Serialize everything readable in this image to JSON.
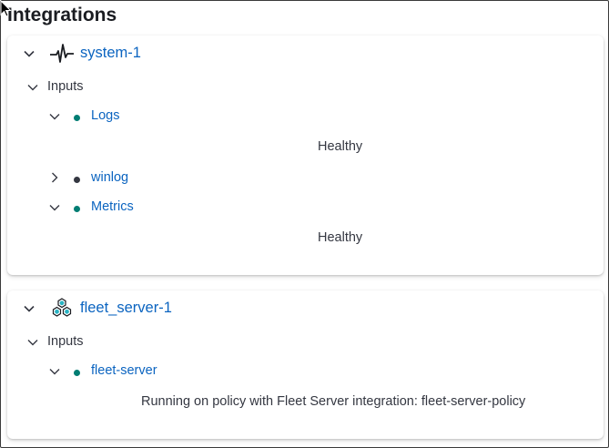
{
  "page": {
    "title": "Integrations"
  },
  "colors": {
    "link": "#0b64c0",
    "healthy": "#017d73",
    "unknown": "#343741",
    "text": "#343741"
  },
  "integrations": [
    {
      "name": "system-1",
      "icon": "heartbeat-icon",
      "inputs_label": "Inputs",
      "inputs": [
        {
          "name": "Logs",
          "status": "healthy",
          "expanded": true,
          "message": "Healthy"
        },
        {
          "name": "winlog",
          "status": "unknown",
          "expanded": false
        },
        {
          "name": "Metrics",
          "status": "healthy",
          "expanded": true,
          "message": "Healthy"
        }
      ]
    },
    {
      "name": "fleet_server-1",
      "icon": "fleet-server-icon",
      "inputs_label": "Inputs",
      "inputs": [
        {
          "name": "fleet-server",
          "status": "healthy",
          "expanded": true,
          "message": "Running on policy with Fleet Server integration: fleet-server-policy"
        }
      ]
    }
  ]
}
